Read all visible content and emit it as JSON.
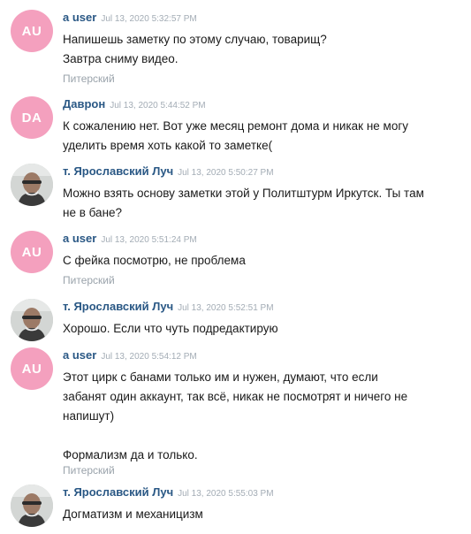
{
  "messages": [
    {
      "author": "a user",
      "time": "Jul 13, 2020 5:32:57 PM",
      "avatar": {
        "type": "initials",
        "text": "AU"
      },
      "lines": [
        "Напишешь заметку по этому случаю, товарищ?",
        "Завтра сниму видео."
      ],
      "subtitle": "Питерский"
    },
    {
      "author": "Даврон",
      "time": "Jul 13, 2020 5:44:52 PM",
      "avatar": {
        "type": "initials",
        "text": "DA"
      },
      "lines": [
        "К сожалению нет. Вот уже месяц ремонт дома и никак не могу",
        "уделить время хоть какой то заметке("
      ]
    },
    {
      "author": "т. Ярославский Луч",
      "time": "Jul 13, 2020 5:50:27 PM",
      "avatar": {
        "type": "photo"
      },
      "lines": [
        "Можно взять основу заметки этой у Политштурм Иркутск. Ты там",
        "не в бане?"
      ]
    },
    {
      "author": "a user",
      "time": "Jul 13, 2020 5:51:24 PM",
      "avatar": {
        "type": "initials",
        "text": "AU"
      },
      "lines": [
        "С фейка посмотрю, не проблема"
      ],
      "subtitle": "Питерский"
    },
    {
      "author": "т. Ярославский Луч",
      "time": "Jul 13, 2020 5:52:51 PM",
      "avatar": {
        "type": "photo"
      },
      "lines": [
        "Хорошо. Если что чуть подредактирую"
      ]
    },
    {
      "author": "a user",
      "time": "Jul 13, 2020 5:54:12 PM",
      "avatar": {
        "type": "initials",
        "text": "AU"
      },
      "lines": [
        "Этот цирк с банами только им и нужен, думают, что если",
        "забанят один аккаунт, так всё, никак не посмотрят и ничего не",
        "напишут)",
        "",
        "Формализм да и только."
      ],
      "subtitle": "Питерский"
    },
    {
      "author": "т. Ярославский Луч",
      "time": "Jul 13, 2020 5:55:03 PM",
      "avatar": {
        "type": "photo"
      },
      "lines": [
        "Догматизм и механицизм"
      ]
    }
  ]
}
